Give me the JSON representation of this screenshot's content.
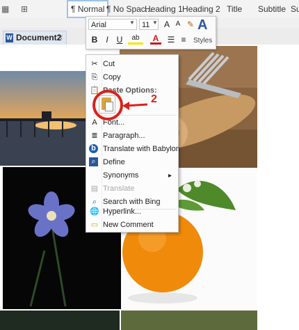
{
  "ribbon": {
    "styles": [
      "¶ Normal",
      "¶ No Spac...",
      "Heading 1",
      "Heading 2",
      "Title",
      "Subtitle",
      "Su"
    ]
  },
  "document_tab": {
    "label": "Document2",
    "close": "×"
  },
  "mini_toolbar": {
    "font_name": "Arial",
    "font_size": "11",
    "grow_font": "A",
    "shrink_font": "A",
    "bold": "B",
    "italic": "I",
    "underline": "U",
    "highlight": "ab",
    "font_color": "A",
    "styles_label": "Styles",
    "styles_glyph": "A"
  },
  "context_menu": {
    "items": [
      {
        "label": "Cut",
        "icon": "scissors-icon",
        "disabled": false
      },
      {
        "label": "Copy",
        "icon": "copy-icon",
        "disabled": false
      },
      {
        "label": "Paste Options:",
        "icon": "paste-icon",
        "disabled": false
      },
      {
        "label": "Font...",
        "icon": "font-icon",
        "disabled": false
      },
      {
        "label": "Paragraph...",
        "icon": "paragraph-icon",
        "disabled": false
      },
      {
        "label": "Translate with Babylon",
        "icon": "babylon-icon",
        "disabled": false
      },
      {
        "label": "Define",
        "icon": "define-icon",
        "disabled": false
      },
      {
        "label": "Synonyms",
        "icon": "",
        "disabled": false,
        "submenu": "▸"
      },
      {
        "label": "Translate",
        "icon": "translate-icon",
        "disabled": true
      },
      {
        "label": "Search with Bing",
        "icon": "search-icon",
        "disabled": false
      },
      {
        "label": "Hyperlink...",
        "icon": "hyperlink-icon",
        "disabled": false
      },
      {
        "label": "New Comment",
        "icon": "comment-icon",
        "disabled": false
      }
    ]
  },
  "annotation": {
    "number": "2",
    "color": "#d9221c"
  },
  "colors": {
    "accent": "#2b579a",
    "annotation_red": "#d9221c"
  }
}
